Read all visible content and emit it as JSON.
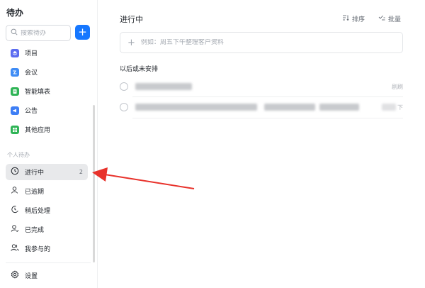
{
  "sidebar": {
    "title": "待办",
    "search_placeholder": "搜索待办",
    "add_label": "+",
    "apps": [
      {
        "label": "项目",
        "color": "#5b6cf0"
      },
      {
        "label": "会议",
        "color": "#3f8cf5"
      },
      {
        "label": "智能填表",
        "color": "#2fb456"
      },
      {
        "label": "公告",
        "color": "#3d7ef5"
      },
      {
        "label": "其他应用",
        "color": "#2fb456"
      }
    ],
    "section_label": "个人待办",
    "personal": [
      {
        "label": "进行中",
        "count": "2"
      },
      {
        "label": "已逾期"
      },
      {
        "label": "稍后处理"
      },
      {
        "label": "已完成"
      },
      {
        "label": "我参与的"
      }
    ],
    "settings_label": "设置"
  },
  "main": {
    "title": "进行中",
    "sort_label": "排序",
    "batch_label": "批量",
    "new_task_placeholder": "例如：周五下午整理客户资料",
    "group_label": "以后或未安排",
    "tasks": [
      {
        "side_text": "剧刷"
      },
      {
        "side_text": "下"
      }
    ]
  },
  "colors": {
    "accent": "#1677ff",
    "annotation_arrow": "#e8322b"
  }
}
